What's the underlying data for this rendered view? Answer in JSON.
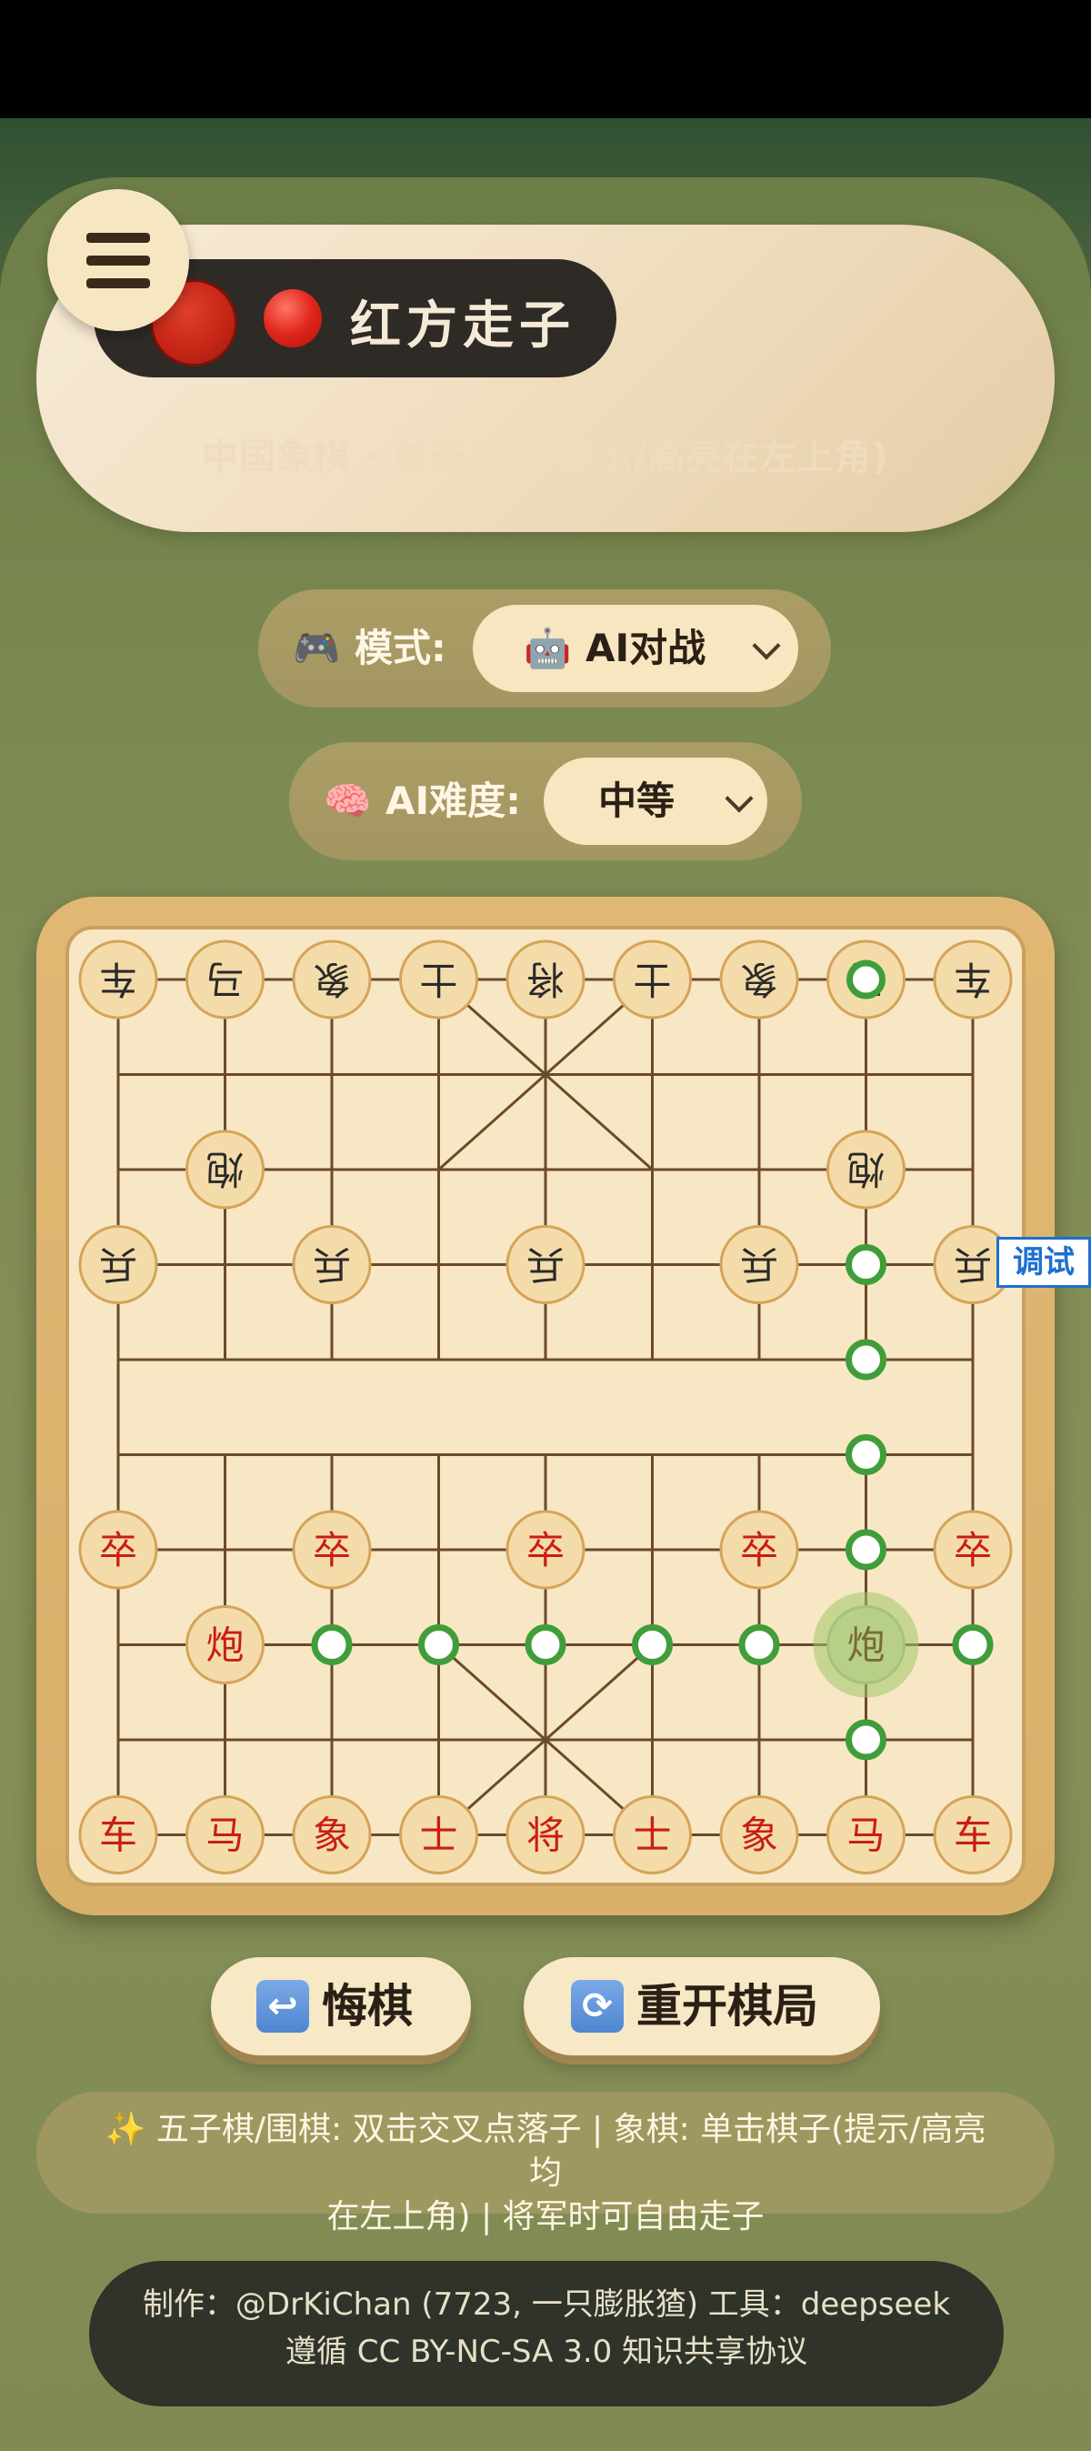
{
  "header": {
    "turn_text": "红方走子",
    "subtitle": "中国象棋 · 单击棋子(提示/高亮在左上角)"
  },
  "mode": {
    "icon": "gamepad-icon",
    "label": "模式:",
    "icon_emoji": "🎮",
    "selected_icon": "🤖",
    "selected": "AI对战"
  },
  "difficulty": {
    "icon": "brain-icon",
    "icon_emoji": "🧠",
    "label": "AI难度:",
    "selected": "中等"
  },
  "board": {
    "black_pieces": [
      {
        "label": "车",
        "file": 0,
        "rank": 0
      },
      {
        "label": "马",
        "file": 1,
        "rank": 0
      },
      {
        "label": "象",
        "file": 2,
        "rank": 0
      },
      {
        "label": "士",
        "file": 3,
        "rank": 0
      },
      {
        "label": "将",
        "file": 4,
        "rank": 0
      },
      {
        "label": "士",
        "file": 5,
        "rank": 0
      },
      {
        "label": "象",
        "file": 6,
        "rank": 0
      },
      {
        "label": "马",
        "file": 7,
        "rank": 0
      },
      {
        "label": "车",
        "file": 8,
        "rank": 0
      },
      {
        "label": "炮",
        "file": 1,
        "rank": 2
      },
      {
        "label": "炮",
        "file": 7,
        "rank": 2
      },
      {
        "label": "兵",
        "file": 0,
        "rank": 3
      },
      {
        "label": "兵",
        "file": 2,
        "rank": 3
      },
      {
        "label": "兵",
        "file": 4,
        "rank": 3
      },
      {
        "label": "兵",
        "file": 6,
        "rank": 3
      },
      {
        "label": "兵",
        "file": 8,
        "rank": 3
      }
    ],
    "red_pieces": [
      {
        "label": "卒",
        "file": 0,
        "rank": 6
      },
      {
        "label": "卒",
        "file": 2,
        "rank": 6
      },
      {
        "label": "卒",
        "file": 4,
        "rank": 6
      },
      {
        "label": "卒",
        "file": 6,
        "rank": 6
      },
      {
        "label": "卒",
        "file": 8,
        "rank": 6
      },
      {
        "label": "炮",
        "file": 1,
        "rank": 7
      },
      {
        "label": "车",
        "file": 0,
        "rank": 9
      },
      {
        "label": "马",
        "file": 1,
        "rank": 9
      },
      {
        "label": "象",
        "file": 2,
        "rank": 9
      },
      {
        "label": "士",
        "file": 3,
        "rank": 9
      },
      {
        "label": "将",
        "file": 4,
        "rank": 9
      },
      {
        "label": "士",
        "file": 5,
        "rank": 9
      },
      {
        "label": "象",
        "file": 6,
        "rank": 9
      },
      {
        "label": "马",
        "file": 7,
        "rank": 9
      },
      {
        "label": "车",
        "file": 8,
        "rank": 9
      }
    ],
    "selected_piece": {
      "label": "炮",
      "file": 7,
      "rank": 7
    },
    "move_hints": [
      {
        "file": 7,
        "rank": 0
      },
      {
        "file": 7,
        "rank": 3
      },
      {
        "file": 7,
        "rank": 4
      },
      {
        "file": 7,
        "rank": 5
      },
      {
        "file": 7,
        "rank": 6
      },
      {
        "file": 2,
        "rank": 7
      },
      {
        "file": 3,
        "rank": 7
      },
      {
        "file": 4,
        "rank": 7
      },
      {
        "file": 5,
        "rank": 7
      },
      {
        "file": 6,
        "rank": 7
      },
      {
        "file": 8,
        "rank": 7
      },
      {
        "file": 7,
        "rank": 8
      }
    ],
    "colors": {
      "red_text": "#c81e14",
      "black_text": "#2a2a2a",
      "piece_fill": "#f4dcaa",
      "piece_border": "#d5a458",
      "hint_ring": "#3f9e3a",
      "selected_glow": "#9cc86a",
      "grid": "#6b4a2c"
    }
  },
  "debug_label": "调试",
  "actions": {
    "undo_icon": "↩",
    "undo_label": "悔棋",
    "restart_icon": "🔄",
    "restart_label": "重开棋局"
  },
  "tips": {
    "line1": "✨ 五子棋/围棋: 双击交叉点落子 | 象棋: 单击棋子(提示/高亮均",
    "line2": "在左上角) | 将军时可自由走子"
  },
  "footer": {
    "line1": "制作：@DrKiChan (7723, 一只膨胀猹) 工具：deepseek",
    "line2": "遵循 CC BY-NC-SA 3.0 知识共享协议"
  }
}
